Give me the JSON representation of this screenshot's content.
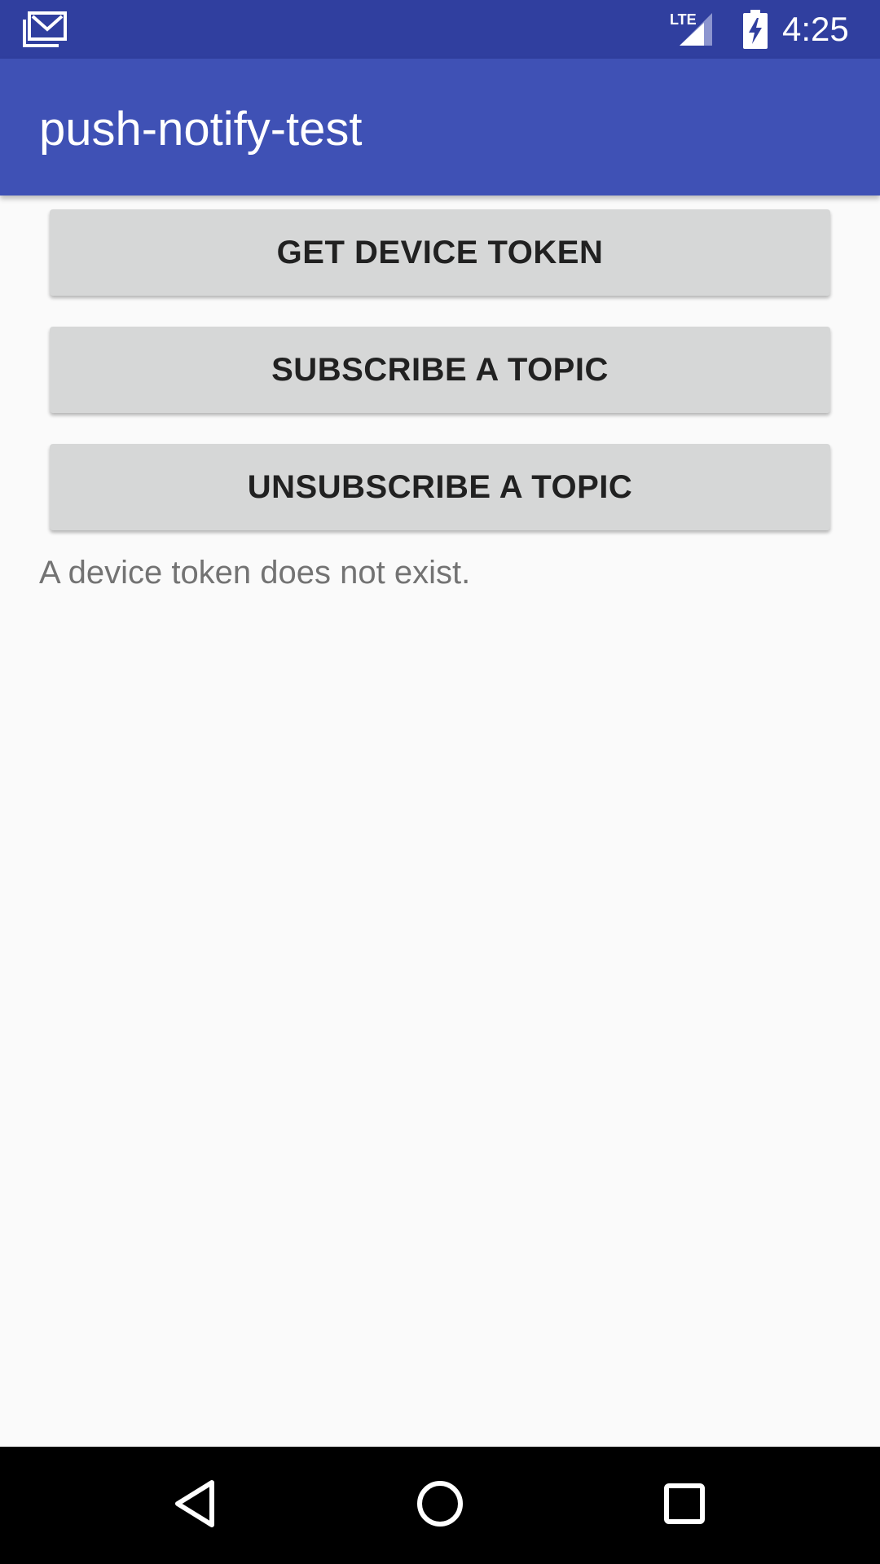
{
  "status_bar": {
    "time": "4:25",
    "network_label": "LTE",
    "left_icon": "gmail-notification-icon",
    "signal_icon": "cell-signal-icon",
    "battery_icon": "battery-charging-icon"
  },
  "app_bar": {
    "title": "push-notify-test",
    "color": "#3f51b5",
    "status_color": "#303f9f"
  },
  "buttons": {
    "get_device_token": "GET DEVICE TOKEN",
    "subscribe_topic": "SUBSCRIBE A TOPIC",
    "unsubscribe_topic": "UNSUBSCRIBE A TOPIC"
  },
  "status_message": "A device token does not exist.",
  "nav_bar": {
    "back_icon": "back-triangle-icon",
    "home_icon": "home-circle-icon",
    "recents_icon": "recents-square-icon"
  }
}
